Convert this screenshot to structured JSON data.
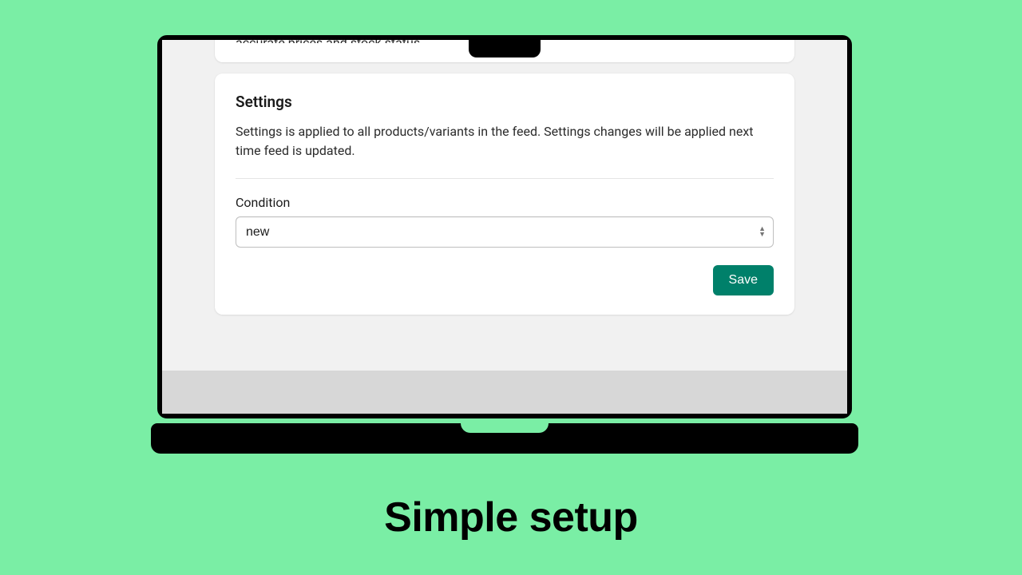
{
  "peek_card": {
    "partial_text": "accurate prices and stock status."
  },
  "settings_card": {
    "title": "Settings",
    "description": "Settings is applied to all products/variants in the feed. Settings changes will be applied next time feed is updated.",
    "condition_label": "Condition",
    "condition_value": "new",
    "save_label": "Save"
  },
  "headline": "Simple setup",
  "colors": {
    "background": "#7aeea5",
    "primary_button": "#00806a"
  }
}
